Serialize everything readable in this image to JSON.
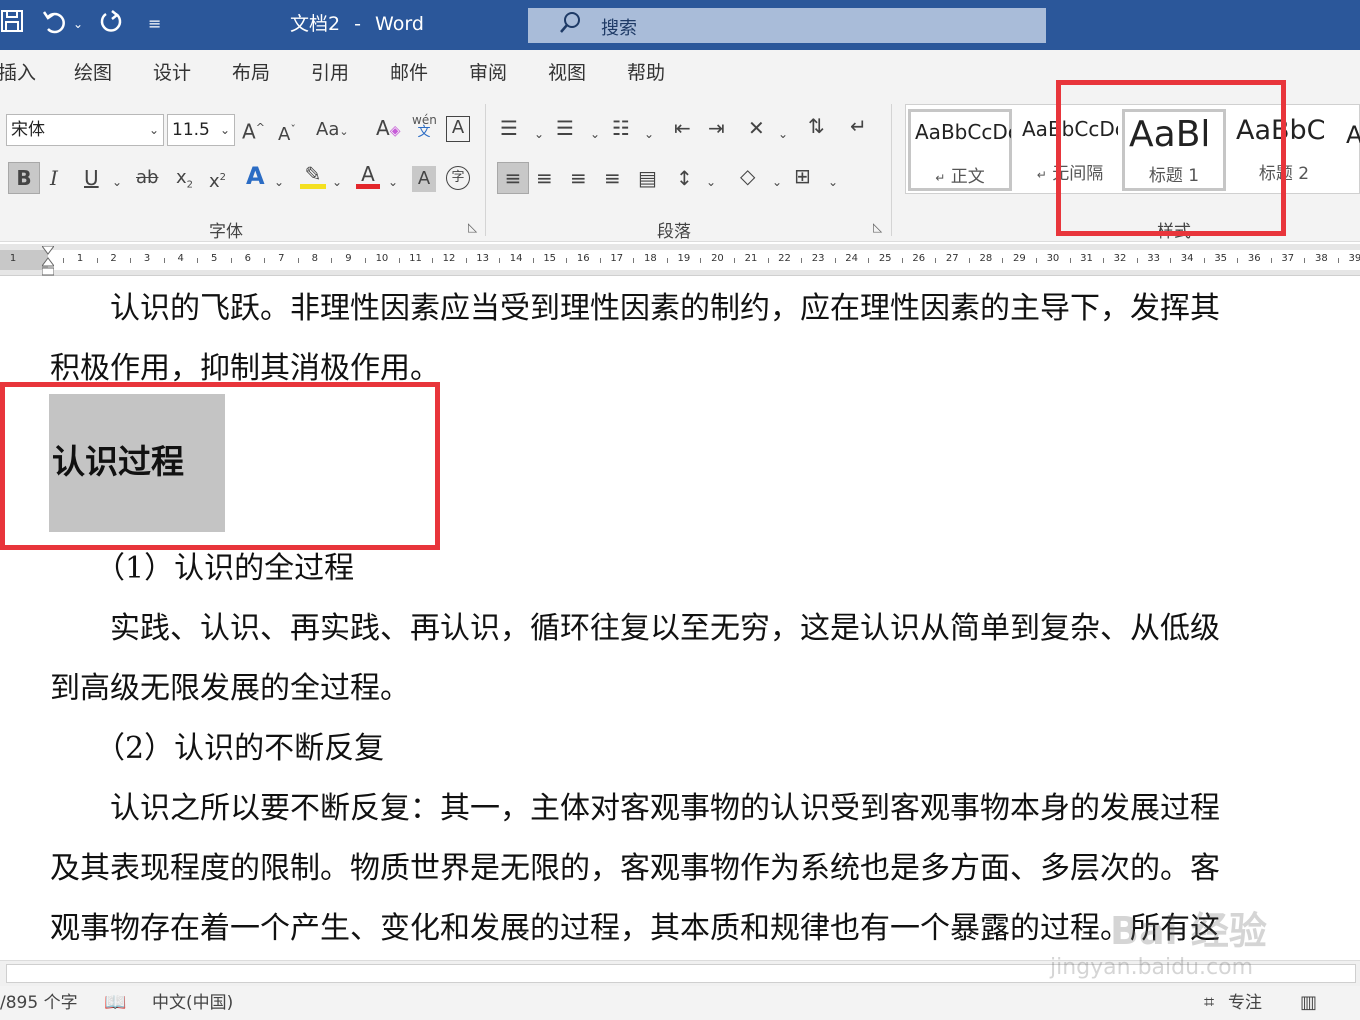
{
  "titlebar": {
    "doc_name": "文档2",
    "separator": "-",
    "app_name": "Word",
    "search_label": "搜索"
  },
  "menu": {
    "tabs": [
      "插入",
      "绘图",
      "设计",
      "布局",
      "引用",
      "邮件",
      "审阅",
      "视图",
      "帮助"
    ]
  },
  "ribbon": {
    "font_name": "宋体",
    "font_size": "11.5",
    "font_group_label": "字体",
    "paragraph_group_label": "段落",
    "styles_group_label": "样式",
    "styles": [
      {
        "preview": "AaBbCcDc",
        "name": "正文",
        "marker": "↵"
      },
      {
        "preview": "AaBbCcDc",
        "name": "无间隔",
        "marker": "↵"
      },
      {
        "preview": "AaBl",
        "name": "标题 1",
        "marker": ""
      },
      {
        "preview": "AaBbC",
        "name": "标题 2",
        "marker": ""
      }
    ],
    "overflow_preview": "A",
    "wen_top": "wén",
    "wen_bottom": "文"
  },
  "ruler": {
    "left_number": "1",
    "numbers": [
      "2",
      "4",
      "6",
      "8",
      "10",
      "12",
      "14",
      "16",
      "18",
      "20",
      "22",
      "24",
      "26",
      "28",
      "30",
      "32",
      "34",
      "36",
      "38"
    ],
    "odd_numbers": [
      "1",
      "3",
      "5",
      "7",
      "9",
      "11",
      "13",
      "15",
      "17",
      "19",
      "21",
      "23",
      "25",
      "27",
      "29",
      "31",
      "33",
      "35",
      "37",
      "39"
    ]
  },
  "document": {
    "lines": [
      "　　认识的飞跃。非理性因素应当受到理性因素的制约，应在理性因素的主导下，发挥其",
      "积极作用，抑制其消极作用。"
    ],
    "heading": "认识过程",
    "lines_after": [
      "　　（1）认识的全过程",
      "　　实践、认识、再实践、再认识，循环往复以至无穷，这是认识从简单到复杂、从低级",
      "到高级无限发展的全过程。",
      "　　（2）认识的不断反复",
      "　　认识之所以要不断反复：其一，主体对客观事物的认识受到客观事物本身的发展过程",
      "及其表现程度的限制。物质世界是无限的，客观事物作为系统也是多方面、多层次的。客",
      "观事物存在着一个产生、变化和发展的过程，其本质和规律也有一个暴露的过程。所有这"
    ]
  },
  "statusbar": {
    "word_count": "/895 个字",
    "language": "中文(中国)",
    "focus_label": "专注"
  },
  "watermark": {
    "brand": "Bai 经验",
    "url": "jingyan.baidu.com"
  },
  "colors": {
    "titlebar": "#2b579a",
    "highlight_box": "#e8353b",
    "heading_shading": "#c4c4c4"
  }
}
